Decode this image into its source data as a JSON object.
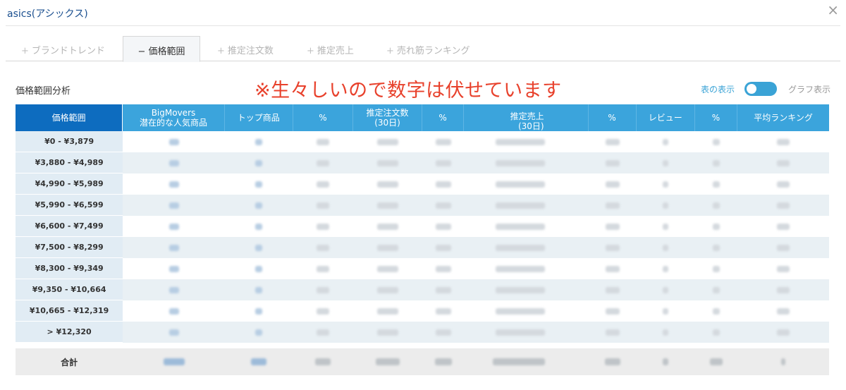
{
  "window": {
    "title": "asics(アシックス)",
    "close_label": "×"
  },
  "tabs": [
    {
      "icon": "+",
      "label": "ブランドトレンド"
    },
    {
      "icon": "−",
      "label": "価格範囲"
    },
    {
      "icon": "+",
      "label": "推定注文数"
    },
    {
      "icon": "+",
      "label": "推定売上"
    },
    {
      "icon": "+",
      "label": "売れ筋ランキング"
    }
  ],
  "section": {
    "title": "価格範囲分析",
    "notice": "※生々しいので数字は伏せています",
    "toggle_left": "表の表示",
    "toggle_right": "グラフ表示"
  },
  "table": {
    "headers": {
      "price_range": "価格範囲",
      "bigmovers": "BigMovers",
      "bigmovers_sub": "潜在的な人気商品",
      "top_products": "トップ商品",
      "pct1": "%",
      "orders": "推定注文数",
      "orders_sub": "(30日)",
      "pct2": "%",
      "sales": "推定売上",
      "sales_sub": "(30日)",
      "pct3": "%",
      "reviews": "レビュー",
      "pct4": "%",
      "avg_rank": "平均ランキング"
    },
    "rows": [
      {
        "range": "¥0 - ¥3,879"
      },
      {
        "range": "¥3,880 - ¥4,989"
      },
      {
        "range": "¥4,990 - ¥5,989"
      },
      {
        "range": "¥5,990 - ¥6,599"
      },
      {
        "range": "¥6,600 - ¥7,499"
      },
      {
        "range": "¥7,500 - ¥8,299"
      },
      {
        "range": "¥8,300 - ¥9,349"
      },
      {
        "range": "¥9,350 - ¥10,664"
      },
      {
        "range": "¥10,665 - ¥12,319"
      },
      {
        "range": "> ¥12,320"
      }
    ],
    "total_label": "合計"
  },
  "colors": {
    "header_bg": "#3ba4dc",
    "header_first_bg": "#0d6cbf",
    "notice": "#e8412c",
    "toggle": "#3aa3d6",
    "title": "#1a4f8f"
  }
}
